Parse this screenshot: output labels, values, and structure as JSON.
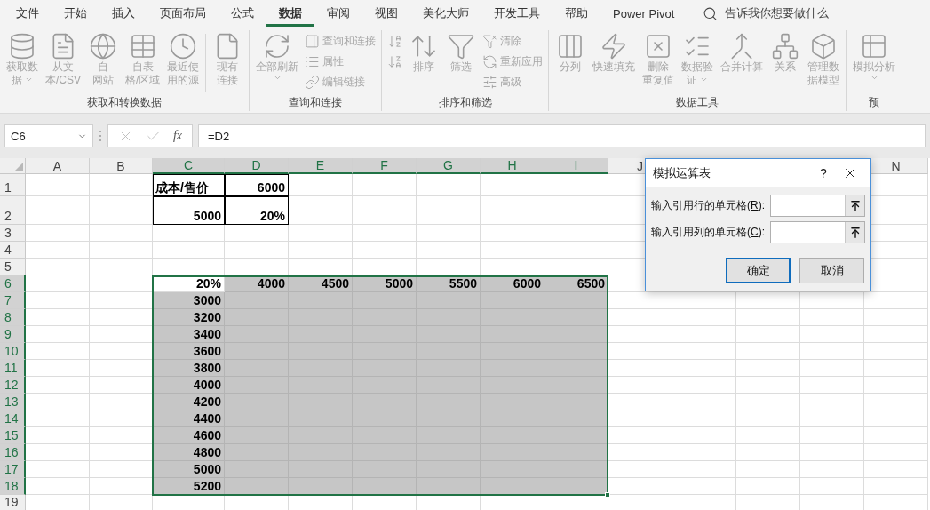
{
  "menu_tabs": [
    {
      "label": "文件",
      "selected": false
    },
    {
      "label": "开始",
      "selected": false
    },
    {
      "label": "插入",
      "selected": false
    },
    {
      "label": "页面布局",
      "selected": false
    },
    {
      "label": "公式",
      "selected": false
    },
    {
      "label": "数据",
      "selected": true
    },
    {
      "label": "审阅",
      "selected": false
    },
    {
      "label": "视图",
      "selected": false
    },
    {
      "label": "美化大师",
      "selected": false
    },
    {
      "label": "开发工具",
      "selected": false
    },
    {
      "label": "帮助",
      "selected": false
    },
    {
      "label": "Power Pivot",
      "selected": false
    }
  ],
  "search": {
    "placeholder": "告诉我你想要做什么"
  },
  "ribbon_groups": [
    {
      "title": "获取和转换数据",
      "items": [
        {
          "kind": "large",
          "lines": [
            "获取数",
            "据"
          ],
          "dropdown": true,
          "disabled": true
        },
        {
          "kind": "large",
          "lines": [
            "从文",
            "本/CSV"
          ],
          "disabled": true
        },
        {
          "kind": "large",
          "lines": [
            "自",
            "网站"
          ],
          "disabled": true
        },
        {
          "kind": "large",
          "lines": [
            "自表",
            "格/区域"
          ],
          "disabled": true
        },
        {
          "kind": "large",
          "lines": [
            "最近使",
            "用的源"
          ],
          "disabled": true
        },
        {
          "kind": "separator"
        },
        {
          "kind": "large",
          "lines": [
            "现有",
            "连接"
          ],
          "disabled": true
        }
      ]
    },
    {
      "title": "查询和连接",
      "items": [
        {
          "kind": "large",
          "lines": [
            "全部刷新"
          ],
          "dropdown": true,
          "disabled": true
        },
        {
          "kind": "stack",
          "items": [
            {
              "label": "查询和连接",
              "disabled": true
            },
            {
              "label": "属性",
              "disabled": true
            },
            {
              "label": "编辑链接",
              "disabled": true
            }
          ]
        }
      ]
    },
    {
      "title": "排序和筛选",
      "items": [
        {
          "kind": "stack",
          "items": [
            {
              "disabled": true
            },
            {
              "disabled": true
            }
          ]
        },
        {
          "kind": "large",
          "lines": [
            "排序"
          ],
          "disabled": true
        },
        {
          "kind": "large",
          "lines": [
            "筛选"
          ],
          "disabled": true
        },
        {
          "kind": "stack",
          "items": [
            {
              "label": "清除",
              "disabled": true
            },
            {
              "label": "重新应用",
              "disabled": true
            },
            {
              "label": "高级",
              "disabled": true
            }
          ]
        }
      ]
    },
    {
      "title": "数据工具",
      "items": [
        {
          "kind": "large",
          "lines": [
            "分列"
          ],
          "disabled": true
        },
        {
          "kind": "large",
          "lines": [
            "快速填充"
          ],
          "disabled": true
        },
        {
          "kind": "large",
          "lines": [
            "删除",
            "重复值"
          ],
          "disabled": true
        },
        {
          "kind": "large",
          "lines": [
            "数据验",
            "证"
          ],
          "dropdown": true,
          "disabled": true
        },
        {
          "kind": "large",
          "lines": [
            "合并计算"
          ],
          "disabled": true
        },
        {
          "kind": "large",
          "lines": [
            "关系"
          ],
          "disabled": true
        },
        {
          "kind": "large",
          "lines": [
            "管理数",
            "据模型"
          ],
          "disabled": true
        }
      ]
    },
    {
      "title": "预",
      "items": [
        {
          "kind": "large",
          "lines": [
            "模拟分析"
          ],
          "dropdown": true,
          "disabled": true
        }
      ]
    }
  ],
  "formula_bar": {
    "name_box": "C6",
    "function_label": "fx",
    "formula": "=D2"
  },
  "sheet": {
    "columns": [
      {
        "label": "A",
        "selected": false
      },
      {
        "label": "B",
        "selected": false
      },
      {
        "label": "C",
        "selected": true
      },
      {
        "label": "D",
        "selected": true
      },
      {
        "label": "E",
        "selected": true
      },
      {
        "label": "F",
        "selected": true
      },
      {
        "label": "G",
        "selected": true
      },
      {
        "label": "H",
        "selected": true
      },
      {
        "label": "I",
        "selected": true
      },
      {
        "label": "J",
        "selected": false
      },
      {
        "label": "N",
        "selected": false
      }
    ],
    "rows": [
      {
        "header": "1",
        "selected": false,
        "cells": {
          "C": {
            "text": "成本/售价",
            "kind": "text",
            "bordered": true
          },
          "D": {
            "text": "6000",
            "kind": "number",
            "bordered": true
          }
        }
      },
      {
        "header": "2",
        "selected": false,
        "cells": {
          "C": {
            "text": "5000",
            "kind": "number",
            "bordered": true
          },
          "D": {
            "text": "20%",
            "kind": "number",
            "bordered": true
          }
        }
      },
      {
        "header": "3",
        "selected": false
      },
      {
        "header": "4",
        "selected": false
      },
      {
        "header": "5",
        "selected": false
      },
      {
        "header": "6",
        "selected": true,
        "cells": {
          "C": {
            "text": "20%",
            "kind": "number",
            "active": true
          },
          "D": {
            "text": "4000",
            "kind": "number"
          },
          "E": {
            "text": "4500",
            "kind": "number"
          },
          "F": {
            "text": "5000",
            "kind": "number"
          },
          "G": {
            "text": "5500",
            "kind": "number"
          },
          "H": {
            "text": "6000",
            "kind": "number"
          },
          "I": {
            "text": "6500",
            "kind": "number"
          }
        }
      },
      {
        "header": "7",
        "selected": true,
        "cells": {
          "C": {
            "text": "3000",
            "kind": "number"
          }
        }
      },
      {
        "header": "8",
        "selected": true,
        "cells": {
          "C": {
            "text": "3200",
            "kind": "number"
          }
        }
      },
      {
        "header": "9",
        "selected": true,
        "cells": {
          "C": {
            "text": "3400",
            "kind": "number"
          }
        }
      },
      {
        "header": "10",
        "selected": true,
        "cells": {
          "C": {
            "text": "3600",
            "kind": "number"
          }
        }
      },
      {
        "header": "11",
        "selected": true,
        "cells": {
          "C": {
            "text": "3800",
            "kind": "number"
          }
        }
      },
      {
        "header": "12",
        "selected": true,
        "cells": {
          "C": {
            "text": "4000",
            "kind": "number"
          }
        }
      },
      {
        "header": "13",
        "selected": true,
        "cells": {
          "C": {
            "text": "4200",
            "kind": "number"
          }
        }
      },
      {
        "header": "14",
        "selected": true,
        "cells": {
          "C": {
            "text": "4400",
            "kind": "number"
          }
        }
      },
      {
        "header": "15",
        "selected": true,
        "cells": {
          "C": {
            "text": "4600",
            "kind": "number"
          }
        }
      },
      {
        "header": "16",
        "selected": true,
        "cells": {
          "C": {
            "text": "4800",
            "kind": "number"
          }
        }
      },
      {
        "header": "17",
        "selected": true,
        "cells": {
          "C": {
            "text": "5000",
            "kind": "number"
          }
        }
      },
      {
        "header": "18",
        "selected": true,
        "cells": {
          "C": {
            "text": "5200",
            "kind": "number"
          }
        }
      },
      {
        "header": "19",
        "selected": false
      }
    ]
  },
  "dialog": {
    "title": "模拟运算表",
    "help": "?",
    "fields": [
      {
        "label_before": "输入引用行的单元格(",
        "access_key": "R",
        "label_after": "):"
      },
      {
        "label_before": "输入引用列的单元格(",
        "access_key": "C",
        "label_after": "):"
      }
    ],
    "buttons": [
      {
        "label": "确定",
        "default": true
      },
      {
        "label": "取消",
        "default": false
      }
    ]
  }
}
